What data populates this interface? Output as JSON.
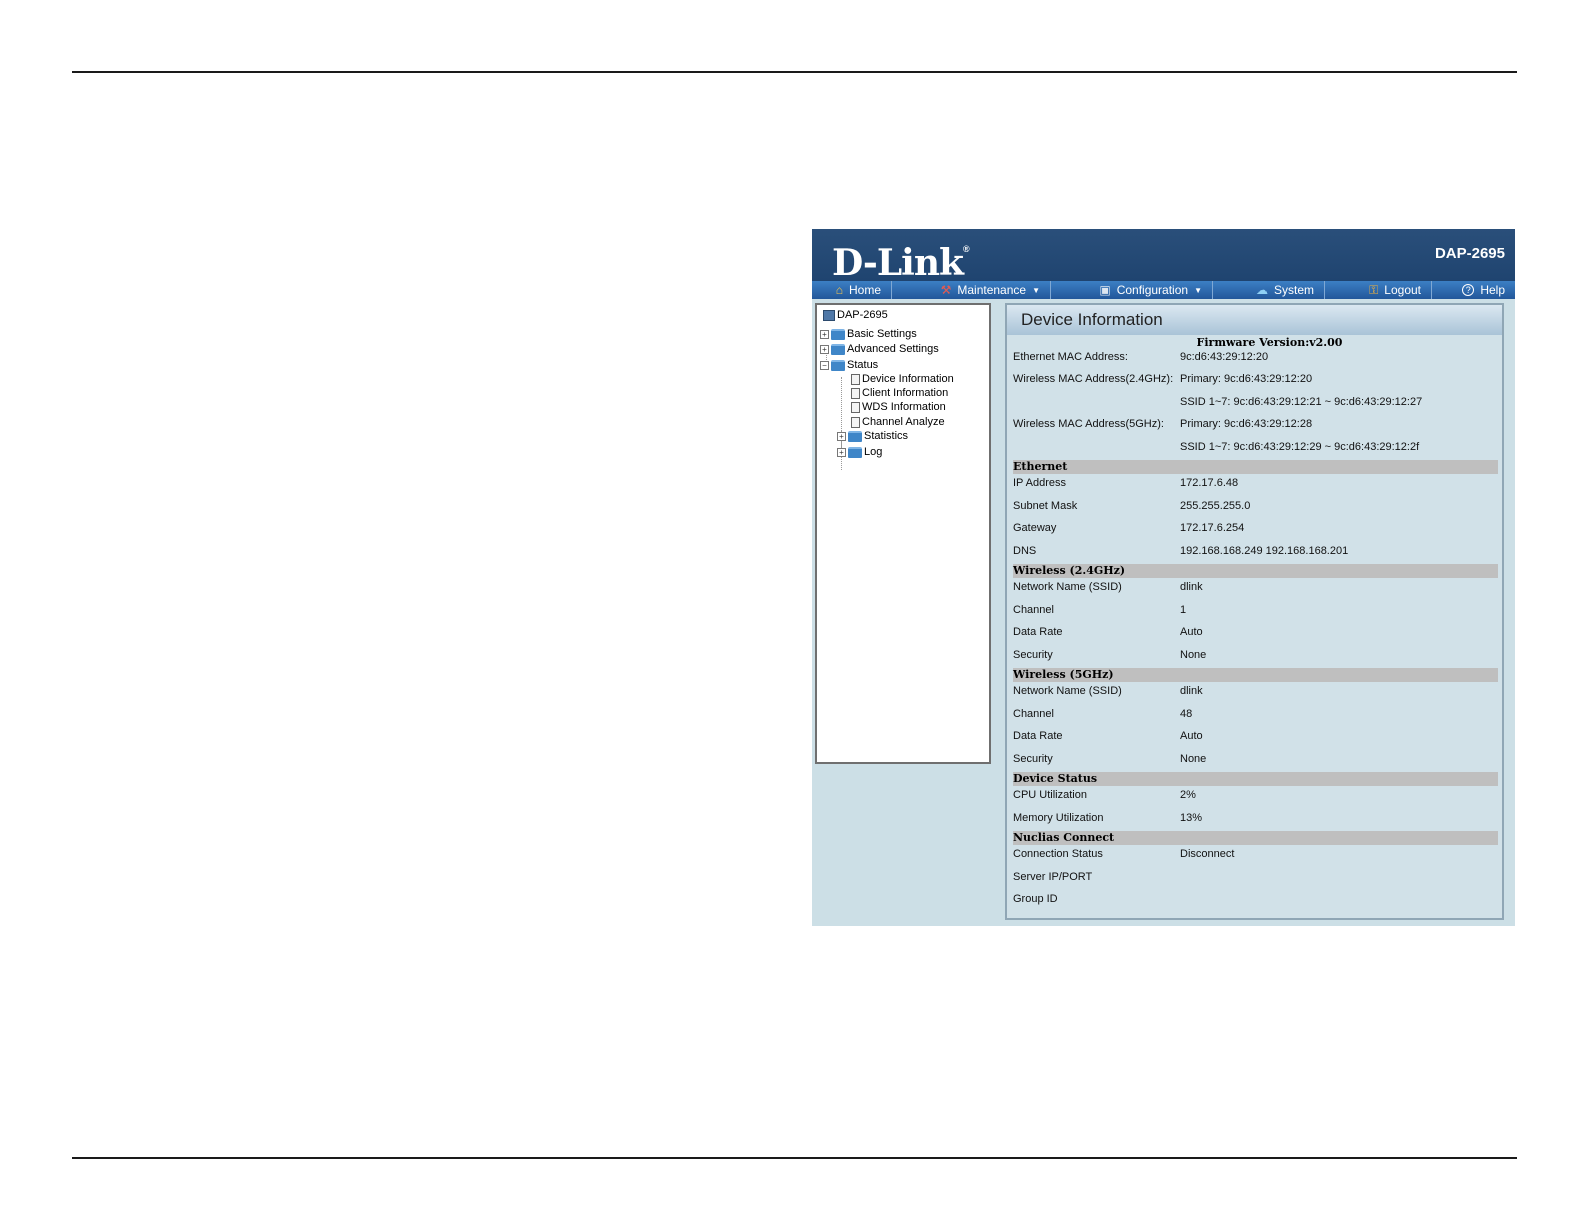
{
  "header": {
    "logo": "D-Link",
    "logo_reg": "®",
    "model": "DAP-2695"
  },
  "menu": [
    {
      "label": "Home",
      "icon": "home-icon",
      "glyph": "⌂",
      "caret": false
    },
    {
      "label": "Maintenance",
      "icon": "tools-icon",
      "glyph": "⚒",
      "caret": true
    },
    {
      "label": "Configuration",
      "icon": "disk-icon",
      "glyph": "▣",
      "caret": true
    },
    {
      "label": "System",
      "icon": "system-icon",
      "glyph": "☁",
      "caret": false
    },
    {
      "label": "Logout",
      "icon": "key-icon",
      "glyph": "⚿",
      "caret": false
    },
    {
      "label": "Help",
      "icon": "help-icon",
      "glyph": "?",
      "caret": false
    }
  ],
  "tree": {
    "root": "DAP-2695",
    "basic": "Basic Settings",
    "advanced": "Advanced Settings",
    "status": "Status",
    "device_info": "Device Information",
    "client_info": "Client Information",
    "wds_info": "WDS Information",
    "channel_analyze": "Channel Analyze",
    "statistics": "Statistics",
    "log": "Log"
  },
  "panel": {
    "title": "Device Information",
    "firmware": "Firmware Version:v2.00",
    "general": [
      {
        "k": "Ethernet MAC Address:",
        "v": "9c:d6:43:29:12:20"
      },
      {
        "k": "Wireless MAC Address(2.4GHz):",
        "v": "Primary: 9c:d6:43:29:12:20"
      },
      {
        "k": "",
        "v": "SSID 1~7: 9c:d6:43:29:12:21 ~ 9c:d6:43:29:12:27"
      },
      {
        "k": "Wireless MAC Address(5GHz):",
        "v": "Primary: 9c:d6:43:29:12:28"
      },
      {
        "k": "",
        "v": "SSID 1~7: 9c:d6:43:29:12:29 ~ 9c:d6:43:29:12:2f"
      }
    ],
    "ethernet": {
      "title": "Ethernet",
      "rows": [
        {
          "k": "IP Address",
          "v": "172.17.6.48"
        },
        {
          "k": "Subnet Mask",
          "v": "255.255.255.0"
        },
        {
          "k": "Gateway",
          "v": "172.17.6.254"
        },
        {
          "k": "DNS",
          "v": "192.168.168.249 192.168.168.201"
        }
      ]
    },
    "wireless24": {
      "title": "Wireless (2.4GHz)",
      "rows": [
        {
          "k": "Network Name (SSID)",
          "v": "dlink"
        },
        {
          "k": "Channel",
          "v": "1"
        },
        {
          "k": "Data Rate",
          "v": "Auto"
        },
        {
          "k": "Security",
          "v": "None"
        }
      ]
    },
    "wireless5": {
      "title": "Wireless (5GHz)",
      "rows": [
        {
          "k": "Network Name (SSID)",
          "v": "dlink"
        },
        {
          "k": "Channel",
          "v": "48"
        },
        {
          "k": "Data Rate",
          "v": "Auto"
        },
        {
          "k": "Security",
          "v": "None"
        }
      ]
    },
    "device_status": {
      "title": "Device Status",
      "rows": [
        {
          "k": "CPU Utilization",
          "v": "2%"
        },
        {
          "k": "Memory Utilization",
          "v": "13%"
        }
      ]
    },
    "nuclias": {
      "title": "Nuclias Connect",
      "rows": [
        {
          "k": "Connection Status",
          "v": "Disconnect"
        },
        {
          "k": "Server IP/PORT",
          "v": ""
        },
        {
          "k": "Group ID",
          "v": ""
        }
      ]
    }
  }
}
